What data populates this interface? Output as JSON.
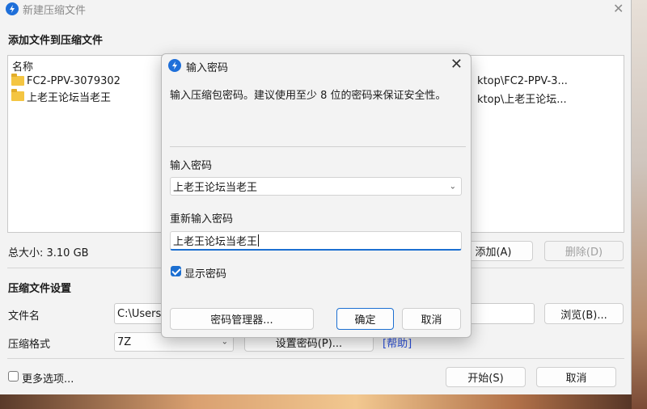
{
  "main_window": {
    "title": "新建压缩文件",
    "add_files_section": "添加文件到压缩文件",
    "file_list": {
      "header": "名称",
      "rows": [
        {
          "name": "FC2-PPV-3079302",
          "path": "ktop\\FC2-PPV-3..."
        },
        {
          "name": "上老王论坛当老王",
          "path": "ktop\\上老王论坛..."
        }
      ]
    },
    "total_size_label": "总大小: 3.10 GB",
    "add_button": "添加(A)",
    "delete_button": "删除(D)",
    "settings_section": "压缩文件设置",
    "filename_label": "文件名",
    "filename_value": "C:\\Users\\",
    "browse_button": "浏览(B)...",
    "format_label": "压缩格式",
    "format_value": "7Z",
    "set_password_button": "设置密码(P)...",
    "help_link": "[帮助]",
    "more_options_label": "更多选项...",
    "start_button": "开始(S)",
    "cancel_button": "取消"
  },
  "dialog": {
    "title": "输入密码",
    "description": "输入压缩包密码。建议使用至少 8 位的密码来保证安全性。",
    "password_label": "输入密码",
    "password_value": "上老王论坛当老王",
    "reenter_label": "重新输入密码",
    "reenter_value": "上老王论坛当老王",
    "show_password_label": "显示密码",
    "show_password_checked": true,
    "manager_button": "密码管理器...",
    "ok_button": "确定",
    "cancel_button": "取消"
  },
  "colors": {
    "accent": "#1c6fd1",
    "link": "#2b4fd8",
    "app_icon": "#1e6fd9"
  }
}
